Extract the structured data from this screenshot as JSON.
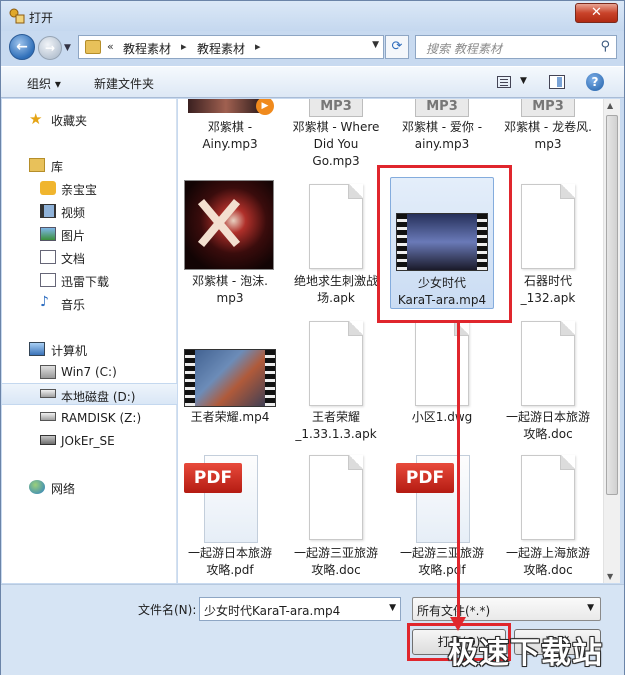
{
  "window": {
    "title": "打开",
    "close": "✕"
  },
  "nav": {
    "path": [
      "教程素材",
      "教程素材"
    ],
    "overflow": "«",
    "search_placeholder": "搜索 教程素材"
  },
  "toolbar": {
    "organize": "组织 ▾",
    "new_folder": "新建文件夹",
    "help": "?"
  },
  "sidebar": {
    "favorites": "收藏夹",
    "libraries": "库",
    "libs": [
      "亲宝宝",
      "视频",
      "图片",
      "文档",
      "迅雷下载",
      "音乐"
    ],
    "computer": "计算机",
    "drives": [
      "Win7 (C:)",
      "本地磁盘 (D:)",
      "RAMDISK (Z:)",
      "JOkEr_SE"
    ],
    "network": "网络"
  },
  "files": {
    "row0": [
      "邓紫棋 -\nAiny.mp3",
      "邓紫棋 - Where\nDid You\nGo.mp3",
      "邓紫棋 - 爱你 -\nainy.mp3",
      "邓紫棋 - 龙卷风.\nmp3"
    ],
    "mp3_label": "MP3",
    "row1": [
      "邓紫棋 - 泡沫.\nmp3",
      "绝地求生刺激战\n场.apk",
      "少女时代\nKaraT-ara.mp4",
      "石器时代\n_132.apk"
    ],
    "row2": [
      "王者荣耀.mp4",
      "王者荣耀\n_1.33.1.3.apk",
      "小区1.dwg",
      "一起游日本旅游\n攻略.doc"
    ],
    "pdf_label": "PDF",
    "row3": [
      "一起游日本旅游\n攻略.pdf",
      "一起游三亚旅游\n攻略.doc",
      "一起游三亚旅游\n攻略.pdf",
      "一起游上海旅游\n攻略.doc"
    ]
  },
  "bottom": {
    "filename_label": "文件名(N):",
    "filename_value": "少女时代KaraT-ara.mp4",
    "filetype_value": "所有文件(*.*)",
    "open": "打开(O)",
    "cancel": "取消"
  },
  "watermark": "极速下载站"
}
